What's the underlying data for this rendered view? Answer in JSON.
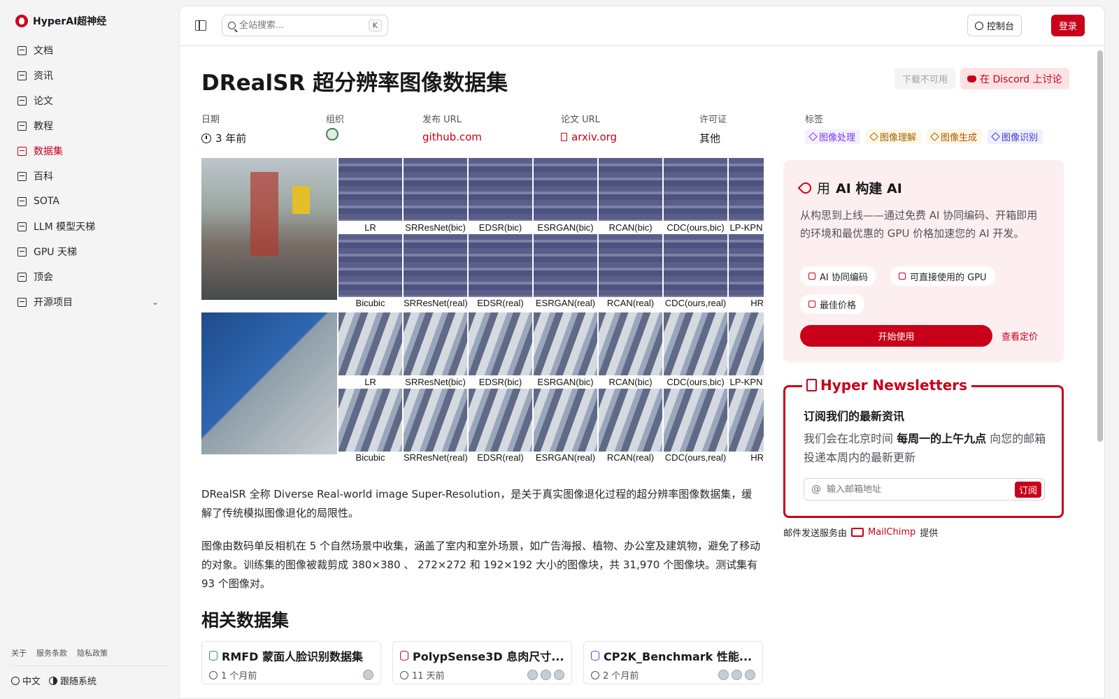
{
  "brand": {
    "name": "HyperAI超神经"
  },
  "sidebar": {
    "items": [
      {
        "label": "文档",
        "icon": "doc-icon"
      },
      {
        "label": "资讯",
        "icon": "news-icon"
      },
      {
        "label": "论文",
        "icon": "paper-icon"
      },
      {
        "label": "教程",
        "icon": "book-icon"
      },
      {
        "label": "数据集",
        "icon": "database-icon",
        "active": true
      },
      {
        "label": "百科",
        "icon": "wiki-icon"
      },
      {
        "label": "SOTA",
        "icon": "chart-icon"
      },
      {
        "label": "LLM 模型天梯",
        "icon": "chip-icon"
      },
      {
        "label": "GPU 天梯",
        "icon": "monitor-icon"
      },
      {
        "label": "顶会",
        "icon": "calendar-icon"
      },
      {
        "label": "开源项目",
        "icon": "list-icon",
        "expandable": true
      }
    ],
    "footer_links": [
      "关于",
      "服务条款",
      "隐私政策"
    ],
    "language": "中文",
    "theme": "跟随系统"
  },
  "topbar": {
    "search_placeholder": "全站搜索...",
    "search_shortcut": " K",
    "console_label": "控制台",
    "login_label": "登录"
  },
  "dataset": {
    "title": "DRealSR 超分辨率图像数据集",
    "download_label": "下载不可用",
    "discord_label": "在 Discord 上讨论",
    "meta": {
      "date_label": "日期",
      "date_value": "3 年前",
      "org_label": "组织",
      "release_label": "发布 URL",
      "release_value": "github.com",
      "paper_label": "论文 URL",
      "paper_value": "arxiv.org",
      "license_label": "许可证",
      "license_value": "其他",
      "tags_label": "标签"
    },
    "tags": [
      {
        "label": "图像处理",
        "color": "#7c3aed",
        "bg": "#f5f0ff"
      },
      {
        "label": "图像理解",
        "color": "#a16207",
        "bg": "#fdf8e4"
      },
      {
        "label": "图像生成",
        "color": "#b45309",
        "bg": "#fdf8e4"
      },
      {
        "label": "图像识别",
        "color": "#4338ca",
        "bg": "#eef0ff"
      }
    ],
    "figure_labels": {
      "row1": [
        "LR",
        "SRResNet(bic)",
        "EDSR(bic)",
        "ESRGAN(bic)",
        "RCAN(bic)",
        "CDC(ours,bic)",
        "LP-KPN"
      ],
      "row2": [
        "Bicubic",
        "SRResNet(real)",
        "EDSR(real)",
        "ESRGAN(real)",
        "RCAN(real)",
        "CDC(ours,real)",
        "HR"
      ]
    },
    "paragraph1": "DRealSR 全称 Diverse Real-world image Super-Resolution，是关于真实图像退化过程的超分辨率图像数据集，缓解了传统模拟图像退化的局限性。",
    "paragraph2": "图像由数码单反相机在 5 个自然场景中收集，涵盖了室内和室外场景，如广告海报、植物、办公室及建筑物，避免了移动的对象。训练集的图像被裁剪成 380×380 、 272×272 和 192×192 大小的图像块，共 31,970 个图像块。测试集有 93 个图像对。",
    "related_title": "相关数据集",
    "related": [
      {
        "title": "RMFD 蒙面人脸识别数据集",
        "time": "1 个月前",
        "color": "#16a34a"
      },
      {
        "title": "PolypSense3D 息肉尺寸...",
        "time": "11 天前",
        "color": "#c8001a"
      },
      {
        "title": "CP2K_Benchmark 性能...",
        "time": "2 个月前",
        "color": "#7c3aed"
      }
    ]
  },
  "promo": {
    "title_prefix": "用",
    "title_bold": "AI 构建 AI",
    "description": "从构思到上线——通过免费 AI 协同编码、开箱即用的环境和最优惠的 GPU 价格加速您的 AI 开发。",
    "chips": [
      "AI 协同编码",
      "可直接使用的 GPU",
      "最佳价格"
    ],
    "start_label": "开始使用",
    "pricing_label": "查看定价"
  },
  "newsletter": {
    "legend": "Hyper Newsletters",
    "heading": "订阅我们的最新资讯",
    "text_before": "我们会在北京时间",
    "text_bold": "每周一的上午九点",
    "text_after": "向您的邮箱投递本周内的最新更新",
    "email_placeholder": "输入邮箱地址",
    "subscribe_label": "订阅",
    "note_prefix": "邮件发送服务由",
    "note_link": "MailChimp",
    "note_suffix": "提供"
  }
}
